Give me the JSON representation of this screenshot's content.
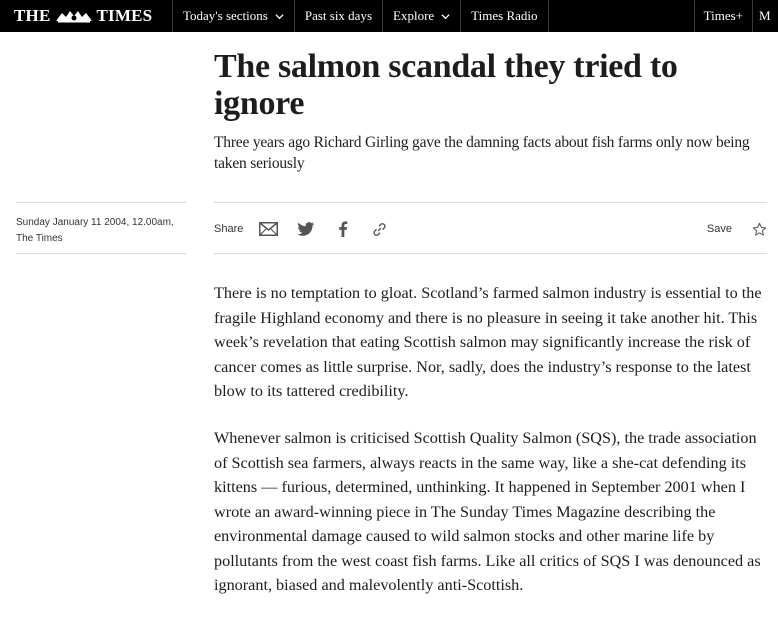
{
  "header": {
    "logo_text_left": "THE",
    "logo_text_right": "TIMES",
    "nav": [
      {
        "label": "Today's sections",
        "has_dropdown": true
      },
      {
        "label": "Past six days",
        "has_dropdown": false
      },
      {
        "label": "Explore",
        "has_dropdown": true
      },
      {
        "label": "Times Radio",
        "has_dropdown": false
      }
    ],
    "right_items": [
      {
        "label": "Times+"
      },
      {
        "label": "M"
      }
    ]
  },
  "article": {
    "headline": "The salmon scandal they tried to ignore",
    "standfirst": "Three years ago Richard Girling gave the damning facts about fish farms only now being taken seriously",
    "date": "Sunday January 11 2004, 12.00am,",
    "source": "The Times",
    "share_label": "Share",
    "share_icons": [
      "email-icon",
      "twitter-icon",
      "facebook-icon",
      "link-icon"
    ],
    "save_label": "Save",
    "paragraphs": [
      "There is no temptation to gloat. Scotland’s farmed salmon industry is essential to the fragile Highland economy and there is no pleasure in seeing it take another hit. This week’s revelation that eating Scottish salmon may significantly increase the risk of cancer comes as little surprise. Nor, sadly, does the industry’s response to the latest blow to its tattered credibility.",
      "Whenever salmon is criticised Scottish Quality Salmon (SQS), the trade association of Scottish sea farmers, always reacts in the same way, like a she-cat defending its kittens — furious, determined, unthinking. It happened in September 2001 when I wrote an award-winning piece in The Sunday Times Magazine describing the environmental damage caused to wild salmon stocks and other marine life by pollutants from the west coast fish farms. Like all critics of SQS I was denounced as ignorant, biased and malevolently anti-Scottish."
    ]
  },
  "colors": {
    "topbar_bg": "#000000",
    "text": "#1d1d1b",
    "rule": "#dcdcdc"
  }
}
